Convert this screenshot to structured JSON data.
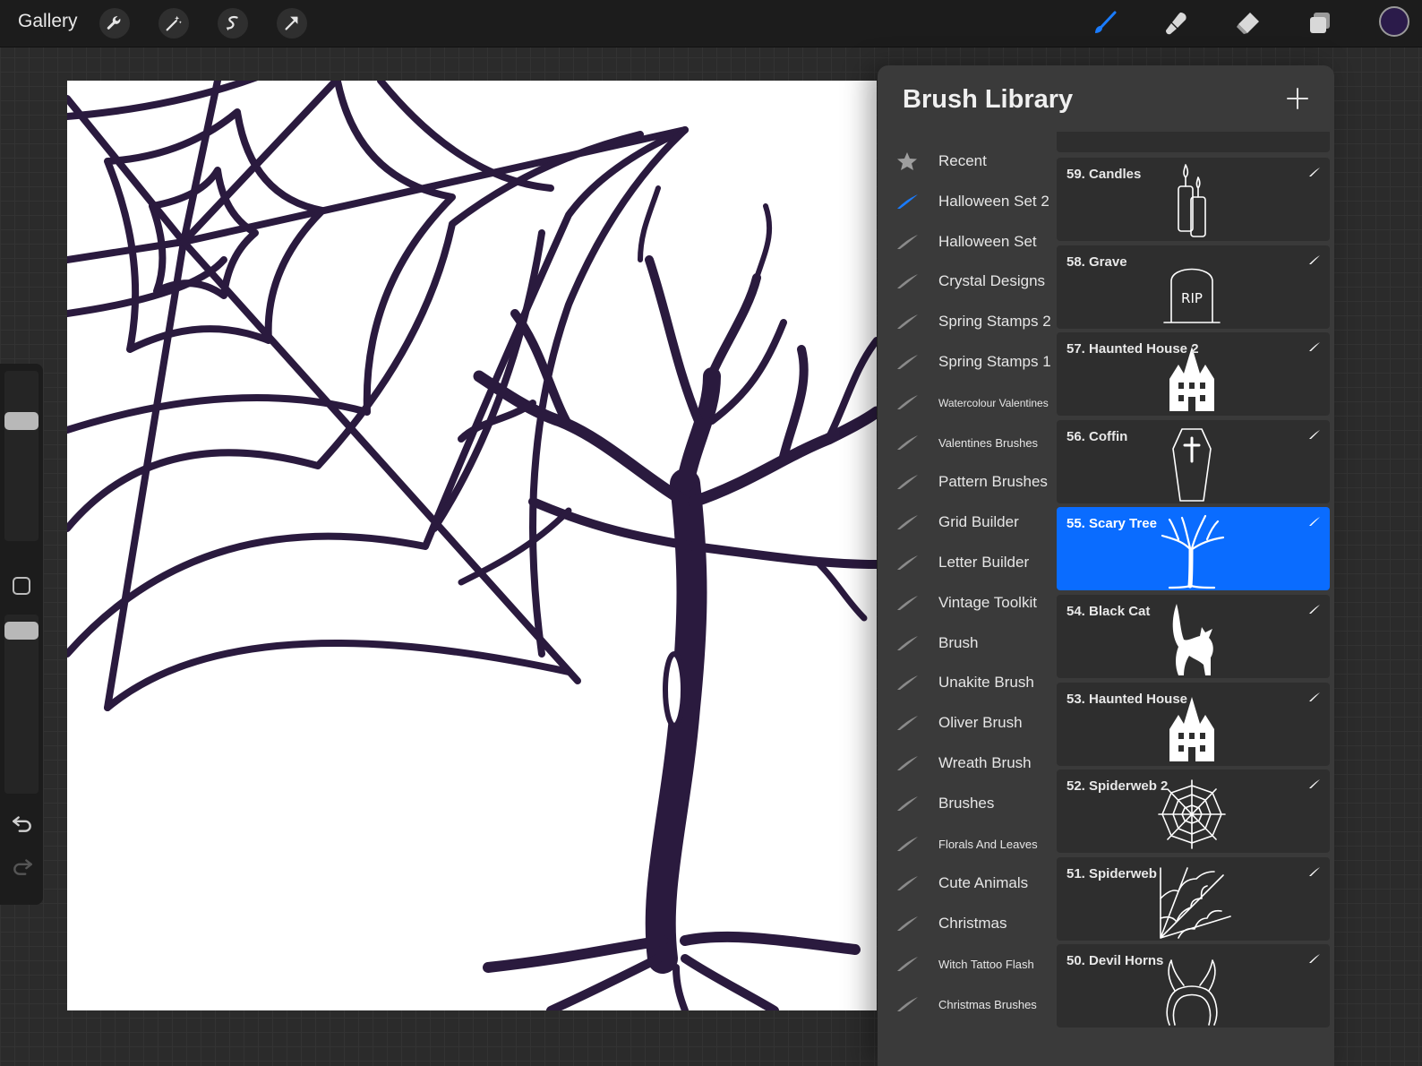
{
  "topbar": {
    "gallery_label": "Gallery",
    "tools": [
      {
        "name": "wrench-icon"
      },
      {
        "name": "magic-wand-icon"
      },
      {
        "name": "selection-icon"
      },
      {
        "name": "transform-arrow-icon"
      }
    ],
    "right_tools": [
      {
        "name": "brush-tool-icon",
        "active": true,
        "color": "#1a7cff"
      },
      {
        "name": "smudge-tool-icon",
        "active": false
      },
      {
        "name": "eraser-tool-icon",
        "active": false
      },
      {
        "name": "layers-icon",
        "active": false
      }
    ],
    "current_color": "#2b1b4a"
  },
  "canvas": {
    "ink_color": "#2a1a3e"
  },
  "library": {
    "title": "Brush Library",
    "sets": [
      {
        "label": "Recent",
        "icon": "star-icon"
      },
      {
        "label": "Halloween Set 2",
        "icon": "brush-stroke-icon",
        "active": true
      },
      {
        "label": "Halloween Set",
        "icon": "brush-stroke-icon"
      },
      {
        "label": "Crystal Designs",
        "icon": "brush-stroke-icon"
      },
      {
        "label": "Spring Stamps 2",
        "icon": "brush-stroke-icon"
      },
      {
        "label": "Spring Stamps 1",
        "icon": "brush-stroke-icon"
      },
      {
        "label": "Watercolour Valentines",
        "icon": "brush-stroke-icon",
        "size": "tiny"
      },
      {
        "label": "Valentines Brushes",
        "icon": "brush-stroke-icon",
        "size": "small"
      },
      {
        "label": "Pattern Brushes",
        "icon": "brush-stroke-icon"
      },
      {
        "label": "Grid Builder",
        "icon": "brush-stroke-icon"
      },
      {
        "label": "Letter Builder",
        "icon": "brush-stroke-icon"
      },
      {
        "label": "Vintage Toolkit",
        "icon": "brush-stroke-icon"
      },
      {
        "label": "Brush",
        "icon": "brush-stroke-icon"
      },
      {
        "label": "Unakite Brush",
        "icon": "brush-stroke-icon"
      },
      {
        "label": "Oliver Brush",
        "icon": "brush-stroke-icon"
      },
      {
        "label": "Wreath Brush",
        "icon": "brush-stroke-icon"
      },
      {
        "label": "Brushes",
        "icon": "brush-stroke-icon"
      },
      {
        "label": "Florals And Leaves",
        "icon": "brush-stroke-icon",
        "size": "small"
      },
      {
        "label": "Cute Animals",
        "icon": "brush-stroke-icon"
      },
      {
        "label": "Christmas",
        "icon": "brush-stroke-icon"
      },
      {
        "label": "Witch Tattoo Flash",
        "icon": "brush-stroke-icon",
        "size": "small"
      },
      {
        "label": "Christmas Brushes",
        "icon": "brush-stroke-icon",
        "size": "small"
      }
    ],
    "brushes": [
      {
        "label": "59. Candles",
        "thumb": "candles-icon"
      },
      {
        "label": "58. Grave",
        "thumb": "grave-icon",
        "thumb_text": "RIP"
      },
      {
        "label": "57. Haunted House 2",
        "thumb": "haunted-house-icon"
      },
      {
        "label": "56. Coffin",
        "thumb": "coffin-icon"
      },
      {
        "label": "55. Scary Tree",
        "thumb": "scary-tree-icon",
        "selected": true
      },
      {
        "label": "54. Black Cat",
        "thumb": "black-cat-icon"
      },
      {
        "label": "53. Haunted House",
        "thumb": "haunted-house-icon"
      },
      {
        "label": "52. Spiderweb 2",
        "thumb": "spiderweb-icon"
      },
      {
        "label": "51. Spiderweb",
        "thumb": "spiderweb-corner-icon"
      },
      {
        "label": "50. Devil Horns",
        "thumb": "devil-horns-icon"
      }
    ]
  }
}
